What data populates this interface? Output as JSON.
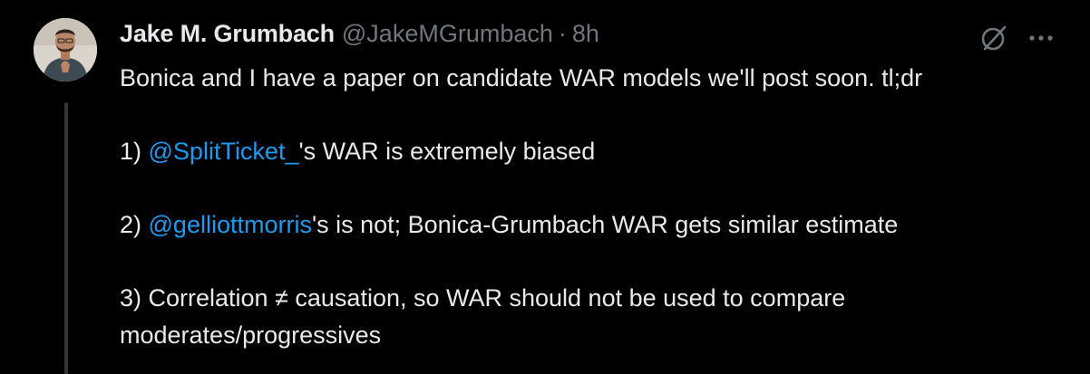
{
  "author": {
    "name": "Jake M. Grumbach",
    "handle": "@JakeMGrumbach",
    "separator": "·",
    "time": "8h"
  },
  "header_icons": [
    "grok-icon",
    "more-options-icon"
  ],
  "text": {
    "line1": "Bonica and I have a paper on candidate WAR models we'll post soon. tl;dr",
    "point1_prefix": "1) ",
    "point1_mention": "@SplitTicket_",
    "point1_rest": "'s WAR is extremely biased",
    "point2_prefix": "2) ",
    "point2_mention": "@gelliottmorris",
    "point2_rest": "'s is not; Bonica-Grumbach WAR gets similar estimate",
    "point3_line1": "3) Correlation ≠ causation, so WAR should not be used to compare",
    "point3_line2": "moderates/progressives"
  },
  "colors": {
    "background": "#000000",
    "text": "#e7e9ea",
    "secondary": "#71767b",
    "link": "#1d9bf0",
    "thread_line": "#333639"
  }
}
